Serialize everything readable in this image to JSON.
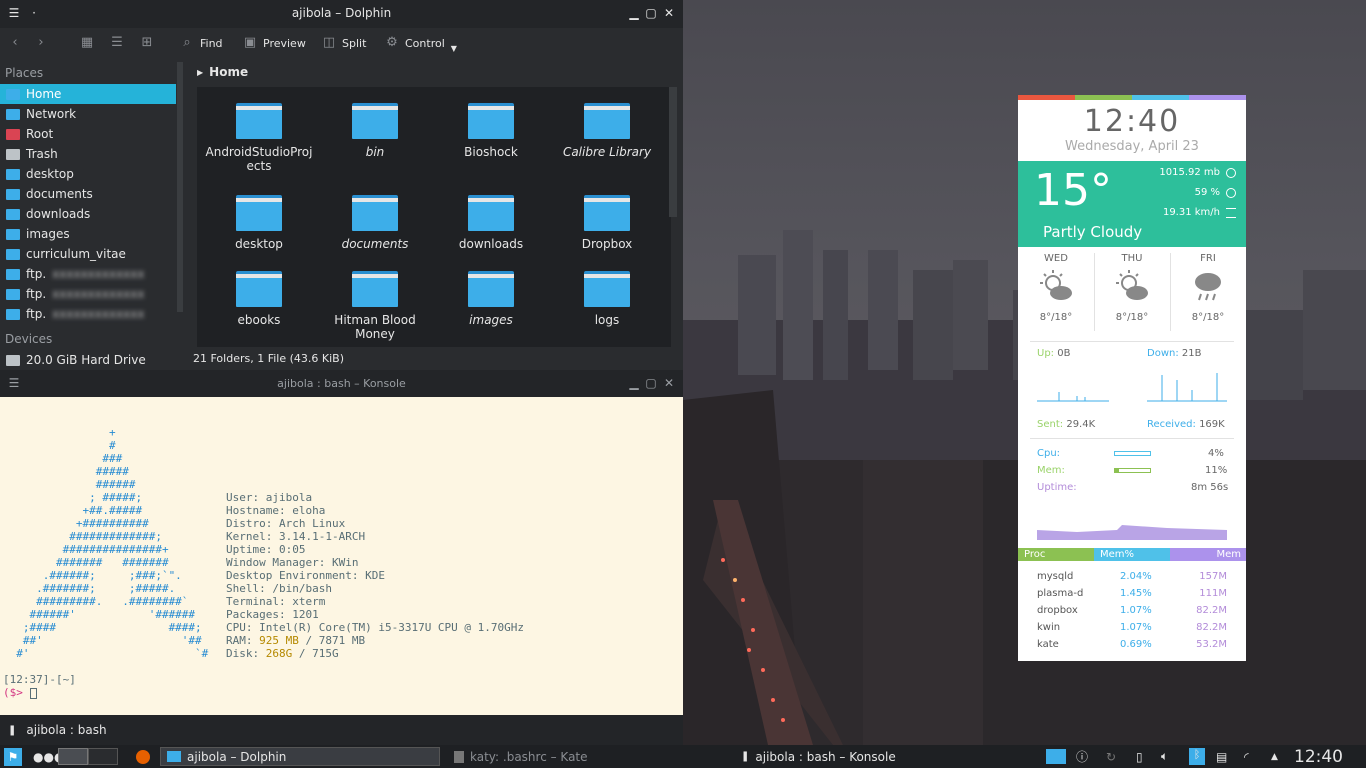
{
  "dolphin": {
    "title": "ajibola – Dolphin",
    "toolbar": {
      "find": "Find",
      "preview": "Preview",
      "split": "Split",
      "control": "Control"
    },
    "places_header": "Places",
    "places": [
      {
        "label": "Home",
        "color": "#3daee9"
      },
      {
        "label": "Network",
        "color": "#3daee9"
      },
      {
        "label": "Root",
        "color": "#da4453"
      },
      {
        "label": "Trash",
        "color": "#bdc3c7"
      },
      {
        "label": "desktop",
        "color": "#3daee9"
      },
      {
        "label": "documents",
        "color": "#3daee9"
      },
      {
        "label": "downloads",
        "color": "#3daee9"
      },
      {
        "label": "images",
        "color": "#3daee9"
      },
      {
        "label": "curriculum_vitae",
        "color": "#3daee9"
      },
      {
        "label": "ftp.",
        "color": "#3daee9"
      },
      {
        "label": "ftp.",
        "color": "#3daee9"
      },
      {
        "label": "ftp.",
        "color": "#3daee9"
      }
    ],
    "devices_header": "Devices",
    "device": "20.0 GiB Hard Drive",
    "breadcrumb": "Home",
    "folders": [
      {
        "name": "AndroidStudioProjects",
        "italic": false
      },
      {
        "name": "bin",
        "italic": true
      },
      {
        "name": "Bioshock",
        "italic": false
      },
      {
        "name": "Calibre Library",
        "italic": true
      },
      {
        "name": "desktop",
        "italic": false
      },
      {
        "name": "documents",
        "italic": true
      },
      {
        "name": "downloads",
        "italic": false
      },
      {
        "name": "Dropbox",
        "italic": false
      },
      {
        "name": "ebooks",
        "italic": false
      },
      {
        "name": "Hitman Blood Money",
        "italic": false
      },
      {
        "name": "images",
        "italic": true
      },
      {
        "name": "logs",
        "italic": false
      }
    ],
    "status": "21 Folders, 1 File (43.6 KiB)"
  },
  "konsole": {
    "title": "ajibola : bash – Konsole",
    "tab": "ajibola : bash",
    "logo": [
      "                +",
      "                #",
      "               ###",
      "              #####",
      "              ######",
      "             ; #####;",
      "            +##.#####",
      "           +##########",
      "          #############;",
      "         ###############+",
      "        #######   #######",
      "      .######;     ;###;`\".",
      "     .#######;     ;#####.",
      "     #########.   .########`",
      "    ######'           '######",
      "   ;####                 ####;",
      "   ##'                     '##",
      "  #'                         `#"
    ],
    "info": [
      {
        "k": "User:",
        "v": "ajibola"
      },
      {
        "k": "Hostname:",
        "v": "eloha"
      },
      {
        "k": "Distro:",
        "v": "Arch Linux"
      },
      {
        "k": "Kernel:",
        "v": "3.14.1-1-ARCH"
      },
      {
        "k": "Uptime:",
        "v": "0:05"
      },
      {
        "k": "Window Manager:",
        "v": "KWin"
      },
      {
        "k": "Desktop Environment:",
        "v": "KDE"
      },
      {
        "k": "Shell:",
        "v": "/bin/bash"
      },
      {
        "k": "Terminal:",
        "v": "xterm"
      },
      {
        "k": "Packages:",
        "v": "1201"
      },
      {
        "k": "CPU:",
        "v": "Intel(R) Core(TM) i5-3317U CPU @ 1.70GHz"
      }
    ],
    "ram_label": "RAM:",
    "ram_used": "925 MB",
    "ram_total": "/ 7871 MB",
    "disk_label": "Disk:",
    "disk_used": "268G",
    "disk_total": "/ 715G",
    "prompt1": "[12:37]-[~]",
    "prompt2": "($>"
  },
  "widget": {
    "time": "12:40",
    "date": "Wednesday, April 23",
    "temp": "15°",
    "condition": "Partly Cloudy",
    "pressure": "1015.92 mb",
    "humidity": "59 %",
    "wind": "19.31 km/h",
    "forecast": [
      {
        "day": "WED",
        "range": "8°/18°",
        "icon": "partly-cloudy-icon"
      },
      {
        "day": "THU",
        "range": "8°/18°",
        "icon": "partly-cloudy-icon"
      },
      {
        "day": "FRI",
        "range": "8°/18°",
        "icon": "rain-icon"
      }
    ],
    "up_label": "Up:",
    "up": "0B",
    "down_label": "Down:",
    "down": "21B",
    "sent_label": "Sent:",
    "sent": "29.4K",
    "received_label": "Received:",
    "received": "169K",
    "cpu_label": "Cpu:",
    "cpu": "4%",
    "mem_label": "Mem:",
    "mem": "11%",
    "uptime_label": "Uptime:",
    "uptime": "8m 56s",
    "proc_headers": [
      "Proc",
      "Mem%",
      "Mem"
    ],
    "procs": [
      {
        "name": "mysqld",
        "pct": "2.04%",
        "mem": "157M"
      },
      {
        "name": "plasma-d",
        "pct": "1.45%",
        "mem": "111M"
      },
      {
        "name": "dropbox",
        "pct": "1.07%",
        "mem": "82.2M"
      },
      {
        "name": "kwin",
        "pct": "1.07%",
        "mem": "82.2M"
      },
      {
        "name": "kate",
        "pct": "0.69%",
        "mem": "53.2M"
      }
    ],
    "colors": {
      "red": "#e9573f",
      "green": "#8cc152",
      "blue": "#4fc1e9",
      "purple": "#ac92ec",
      "teal": "#2dbf9b"
    }
  },
  "taskbar": {
    "tasks": [
      "ajibola – Dolphin",
      "katy: .bashrc – Kate",
      "ajibola : bash – Konsole"
    ],
    "clock": "12:40"
  }
}
